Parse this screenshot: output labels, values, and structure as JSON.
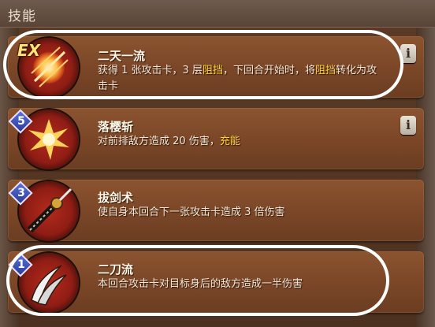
{
  "header": {
    "title": "技能"
  },
  "skills": [
    {
      "name": "二天一流",
      "badge": "EX",
      "desc_parts": [
        "获得 1 张攻击卡，3 层",
        "阻挡",
        "，下回合开始时，将",
        "阻挡",
        "转化为攻击卡"
      ],
      "info": "i"
    },
    {
      "name": "落樱斩",
      "badge": "5",
      "desc_parts": [
        "对前排敌方造成 20 伤害，",
        "充能"
      ],
      "info": "i"
    },
    {
      "name": "拔剑术",
      "badge": "3",
      "desc_parts": [
        "使自身本回合下一张攻击卡造成 3 倍伤害"
      ]
    },
    {
      "name": "二刀流",
      "badge": "1",
      "desc_parts": [
        "本回合攻击卡对目标身后的敌方造成一半伤害"
      ]
    }
  ],
  "colors": {
    "highlight": "#ffd23a",
    "card": "#7a4627",
    "badge": "#3b4fc0"
  }
}
